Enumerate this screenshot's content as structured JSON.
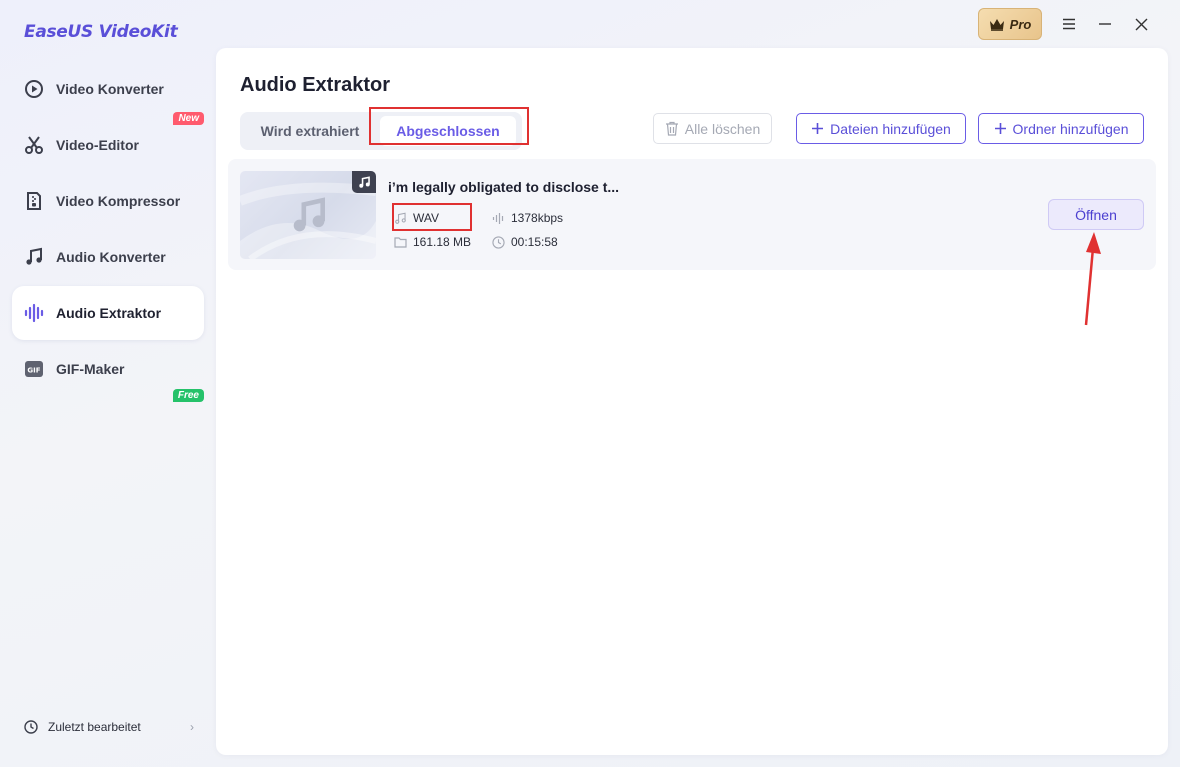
{
  "app": {
    "title": "EaseUS VideoKit",
    "pro_label": "Pro"
  },
  "sidebar": {
    "items": [
      {
        "label": "Video Konverter",
        "icon": "video-convert-icon"
      },
      {
        "label": "Video-Editor",
        "icon": "scissors-icon",
        "tag": "New"
      },
      {
        "label": "Video Kompressor",
        "icon": "compress-icon"
      },
      {
        "label": "Audio Konverter",
        "icon": "music-note-icon"
      },
      {
        "label": "Audio Extraktor",
        "icon": "waveform-icon",
        "active": true
      },
      {
        "label": "GIF-Maker",
        "icon": "gif-icon",
        "tag": "Free"
      }
    ],
    "recent_label": "Zuletzt bearbeitet"
  },
  "main": {
    "title": "Audio Extraktor",
    "tabs": [
      {
        "label": "Wird extrahiert",
        "active": false
      },
      {
        "label": "Abgeschlossen",
        "active": true
      }
    ],
    "clear_all_label": "Alle löschen",
    "add_files_label": "Dateien hinzufügen",
    "add_folder_label": "Ordner hinzufügen",
    "files": [
      {
        "name": "i’m legally obligated to disclose t...",
        "format": "WAV",
        "bitrate": "1378kbps",
        "size": "161.18 MB",
        "duration": "00:15:58",
        "open_label": "Öffnen"
      }
    ]
  },
  "colors": {
    "accent": "#6a5ce6",
    "highlight": "#e03131",
    "new_tag": "#ff5b6e",
    "free_tag": "#25c26a"
  }
}
